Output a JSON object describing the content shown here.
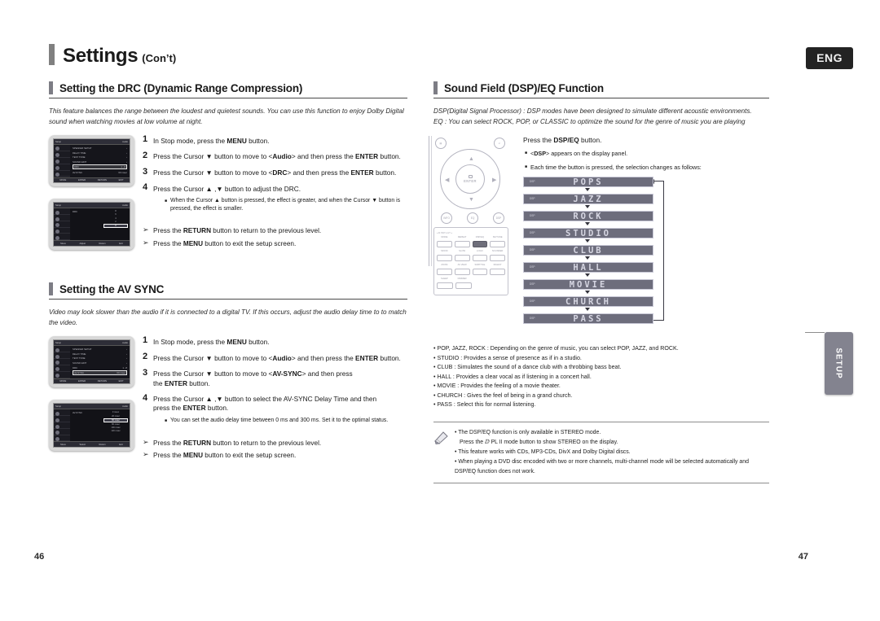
{
  "header": {
    "title": "Settings",
    "subtitle": "(Con’t)",
    "language_badge": "ENG"
  },
  "left_column": {
    "drc": {
      "heading": "Setting the DRC (Dynamic Range Compression)",
      "intro": "This feature balances the range between the loudest and quietest sounds. You can use this function to enjoy Dolby Digital sound when watching movies at low volume at night.",
      "steps": [
        {
          "num": "1",
          "text": "In Stop mode, press the MENU button."
        },
        {
          "num": "2",
          "text": "Press the Cursor ▼ button to move to <Audio> and then press the ENTER button."
        },
        {
          "num": "3",
          "text": "Press the Cursor ▼ button to move to <DRC> and then press the ENTER button."
        },
        {
          "num": "4",
          "text": "Press the Cursor ▲ , ▼ button to adjust the DRC."
        }
      ],
      "substep": "When the Cursor ▲ button is pressed, the effect is greater, and when the Cursor ▼ button is pressed, the effect is smaller.",
      "notes": [
        "Press the RETURN button to return to the previous level.",
        "Press the MENU button to exit the setup screen."
      ]
    },
    "avsync": {
      "heading": "Setting the AV SYNC",
      "intro": "Video may look slower than the audio if it is connected to a digital TV. If this occurs, adjust the audio delay time to to match the video.",
      "steps": [
        {
          "num": "1",
          "text": "In Stop mode, press the MENU button."
        },
        {
          "num": "2",
          "text": "Press the Cursor ▼ button to move to <Audio> and then press the ENTER button."
        },
        {
          "num": "3",
          "text": "Press the Cursor ▼ button to move to <AV-SYNC> and then press the ENTER button."
        },
        {
          "num": "4",
          "text": "Press the Cursor ▲ , ▼ button to select the AV-SYNC Delay Time  and then press the ENTER button."
        }
      ],
      "substep": "You can set the audio delay time between 0 ms and 300 ms. Set it to the optimal status.",
      "notes": [
        "Press the RETURN button to return to the previous level.",
        "Press the MENU button to exit the setup screen."
      ]
    },
    "tv_screens": {
      "drc_menu": {
        "title": "Setup",
        "corner": "Audio",
        "rows": [
          "SPEAKER SETUP",
          "DELAY TIME",
          "TEST TONE",
          "SOUND EDIT"
        ],
        "selected": "DRC",
        "selected_value": "1 - 8",
        "extra_row": "AV-SYNC",
        "extra_value": "60 msec",
        "footer": [
          "MOVE",
          "ENTER",
          "RETURN",
          "EXIT"
        ],
        "side_labels": [
          "Disc Menu",
          "Title Menu",
          "Audio",
          "Setup"
        ]
      },
      "drc_level": {
        "title": "Setup",
        "corner": "Audio",
        "label": "DRC",
        "scale": [
          "8",
          "6",
          "4",
          "2",
          "0"
        ],
        "footer": [
          "Move",
          "Adjust",
          "Return",
          "Exit"
        ]
      },
      "avsync_menu": {
        "title": "Setup",
        "corner": "Audio",
        "rows": [
          "SPEAKER SETUP",
          "DELAY TIME",
          "TEST TONE",
          "SOUND EDIT",
          "DRC"
        ],
        "selected": "AV-SYNC",
        "selected_value": "60 msec",
        "footer": [
          "MOVE",
          "ENTER",
          "RETURN",
          "EXIT"
        ]
      },
      "avsync_list": {
        "title": "Setup",
        "corner": "Audio",
        "label": "AV-SYNC",
        "options": [
          "0 msec",
          "20 msec",
          "40 msec",
          "60 msec",
          "80 msec",
          "100 msec",
          "120 msec"
        ],
        "selected_option": "60 msec",
        "footer": [
          "Move",
          "Select",
          "Return",
          "Exit"
        ]
      }
    }
  },
  "right_column": {
    "heading": "Sound Field (DSP)/EQ Function",
    "intro_line1": "DSP(Digital Signal Processor) : DSP modes have been designed to simulate different acoustic environments.",
    "intro_line2": "EQ : You can select ROCK, POP, or CLASSIC to optimize the sound for the genre of music you are playing",
    "press_line": "Press the DSP/EQ button.",
    "bullets": [
      "<DSP> appears on the display panel.",
      "Each time the button is pressed, the selection changes as follows:"
    ],
    "remote": {
      "enter_label": "ENTER",
      "top_left_icon": "menu-icon",
      "top_right_icon": "return-icon",
      "mid_buttons": [
        "INFO",
        "EQ",
        "DSP"
      ],
      "grid_label": "+DISPLAY+",
      "grid_rows": [
        [
          "MODE",
          "REPEAT",
          "DSP/EQ",
          "SD/TUNE"
        ],
        [
          "MOOD",
          "SLOW",
          "LOGO",
          "SOUNDER"
        ],
        [
          "P.SCAN",
          "NOTE",
          "",
          ""
        ],
        [
          "ZOOM",
          "AV VIEW",
          "SUBTITLE",
          "DIGEST"
        ],
        [
          "SLEEP",
          "DIMMER",
          "",
          ""
        ]
      ],
      "highlighted_button": "DSP/EQ"
    },
    "dsp_display": {
      "tag": "DSP",
      "modes": [
        "POPS",
        "JAZZ",
        "ROCK",
        "STUDIO",
        "CLUB",
        "HALL",
        "MOVIE",
        "CHURCH",
        "PASS"
      ],
      "loops_back_to": "POPS"
    },
    "descriptions": [
      "POP, JAZZ, ROCK : Depending on the genre of music, you can select POP, JAZZ, and ROCK.",
      "STUDIO : Provides a sense of presence as if in a studio.",
      "CLUB : Simulates the sound of a dance club with a throbbing bass beat.",
      "HALL : Provides a clear vocal as if listening in a concert hall.",
      "MOVIE : Provides the feeling of a movie theater.",
      "CHURCH : Gives the feel of being in a grand church.",
      "PASS : Select this for normal listening."
    ],
    "note_box": {
      "icon": "pencil-icon",
      "lines": [
        "The DSP/EQ function is only available in STEREO mode.",
        "Press the ⅅ PL II mode button to show STEREO on the display.",
        "This feature works with CDs, MP3-CDs, DivX and Dolby Digital discs.",
        "When playing a DVD disc encoded with two or more channels, multi-channel mode will be selected automatically and DSP/EQ function does not work."
      ]
    }
  },
  "side_tab": {
    "label": "SETUP"
  },
  "page_numbers": {
    "left": "46",
    "right": "47"
  }
}
